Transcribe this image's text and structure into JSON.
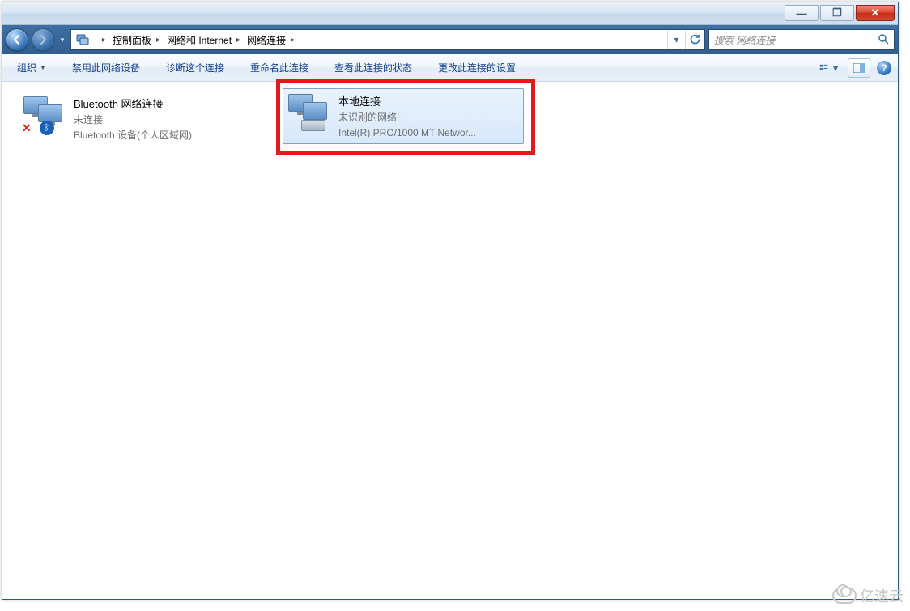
{
  "breadcrumb": {
    "item1": "控制面板",
    "item2": "网络和 Internet",
    "item3": "网络连接"
  },
  "search": {
    "placeholder": "搜索 网络连接"
  },
  "toolbar": {
    "organize": "组织",
    "disable": "禁用此网络设备",
    "diagnose": "诊断这个连接",
    "rename": "重命名此连接",
    "status": "查看此连接的状态",
    "change": "更改此连接的设置"
  },
  "connections": {
    "bluetooth": {
      "title": "Bluetooth 网络连接",
      "status": "未连接",
      "device": "Bluetooth 设备(个人区域网)"
    },
    "local": {
      "title": "本地连接",
      "status": "未识别的网络",
      "device": "Intel(R) PRO/1000 MT Networ..."
    }
  },
  "watermark": "亿速云",
  "help_glyph": "?",
  "bt_glyph": "ᛒ",
  "x_glyph": "✕",
  "win": {
    "min": "—",
    "max": "❐",
    "close": "✕"
  }
}
